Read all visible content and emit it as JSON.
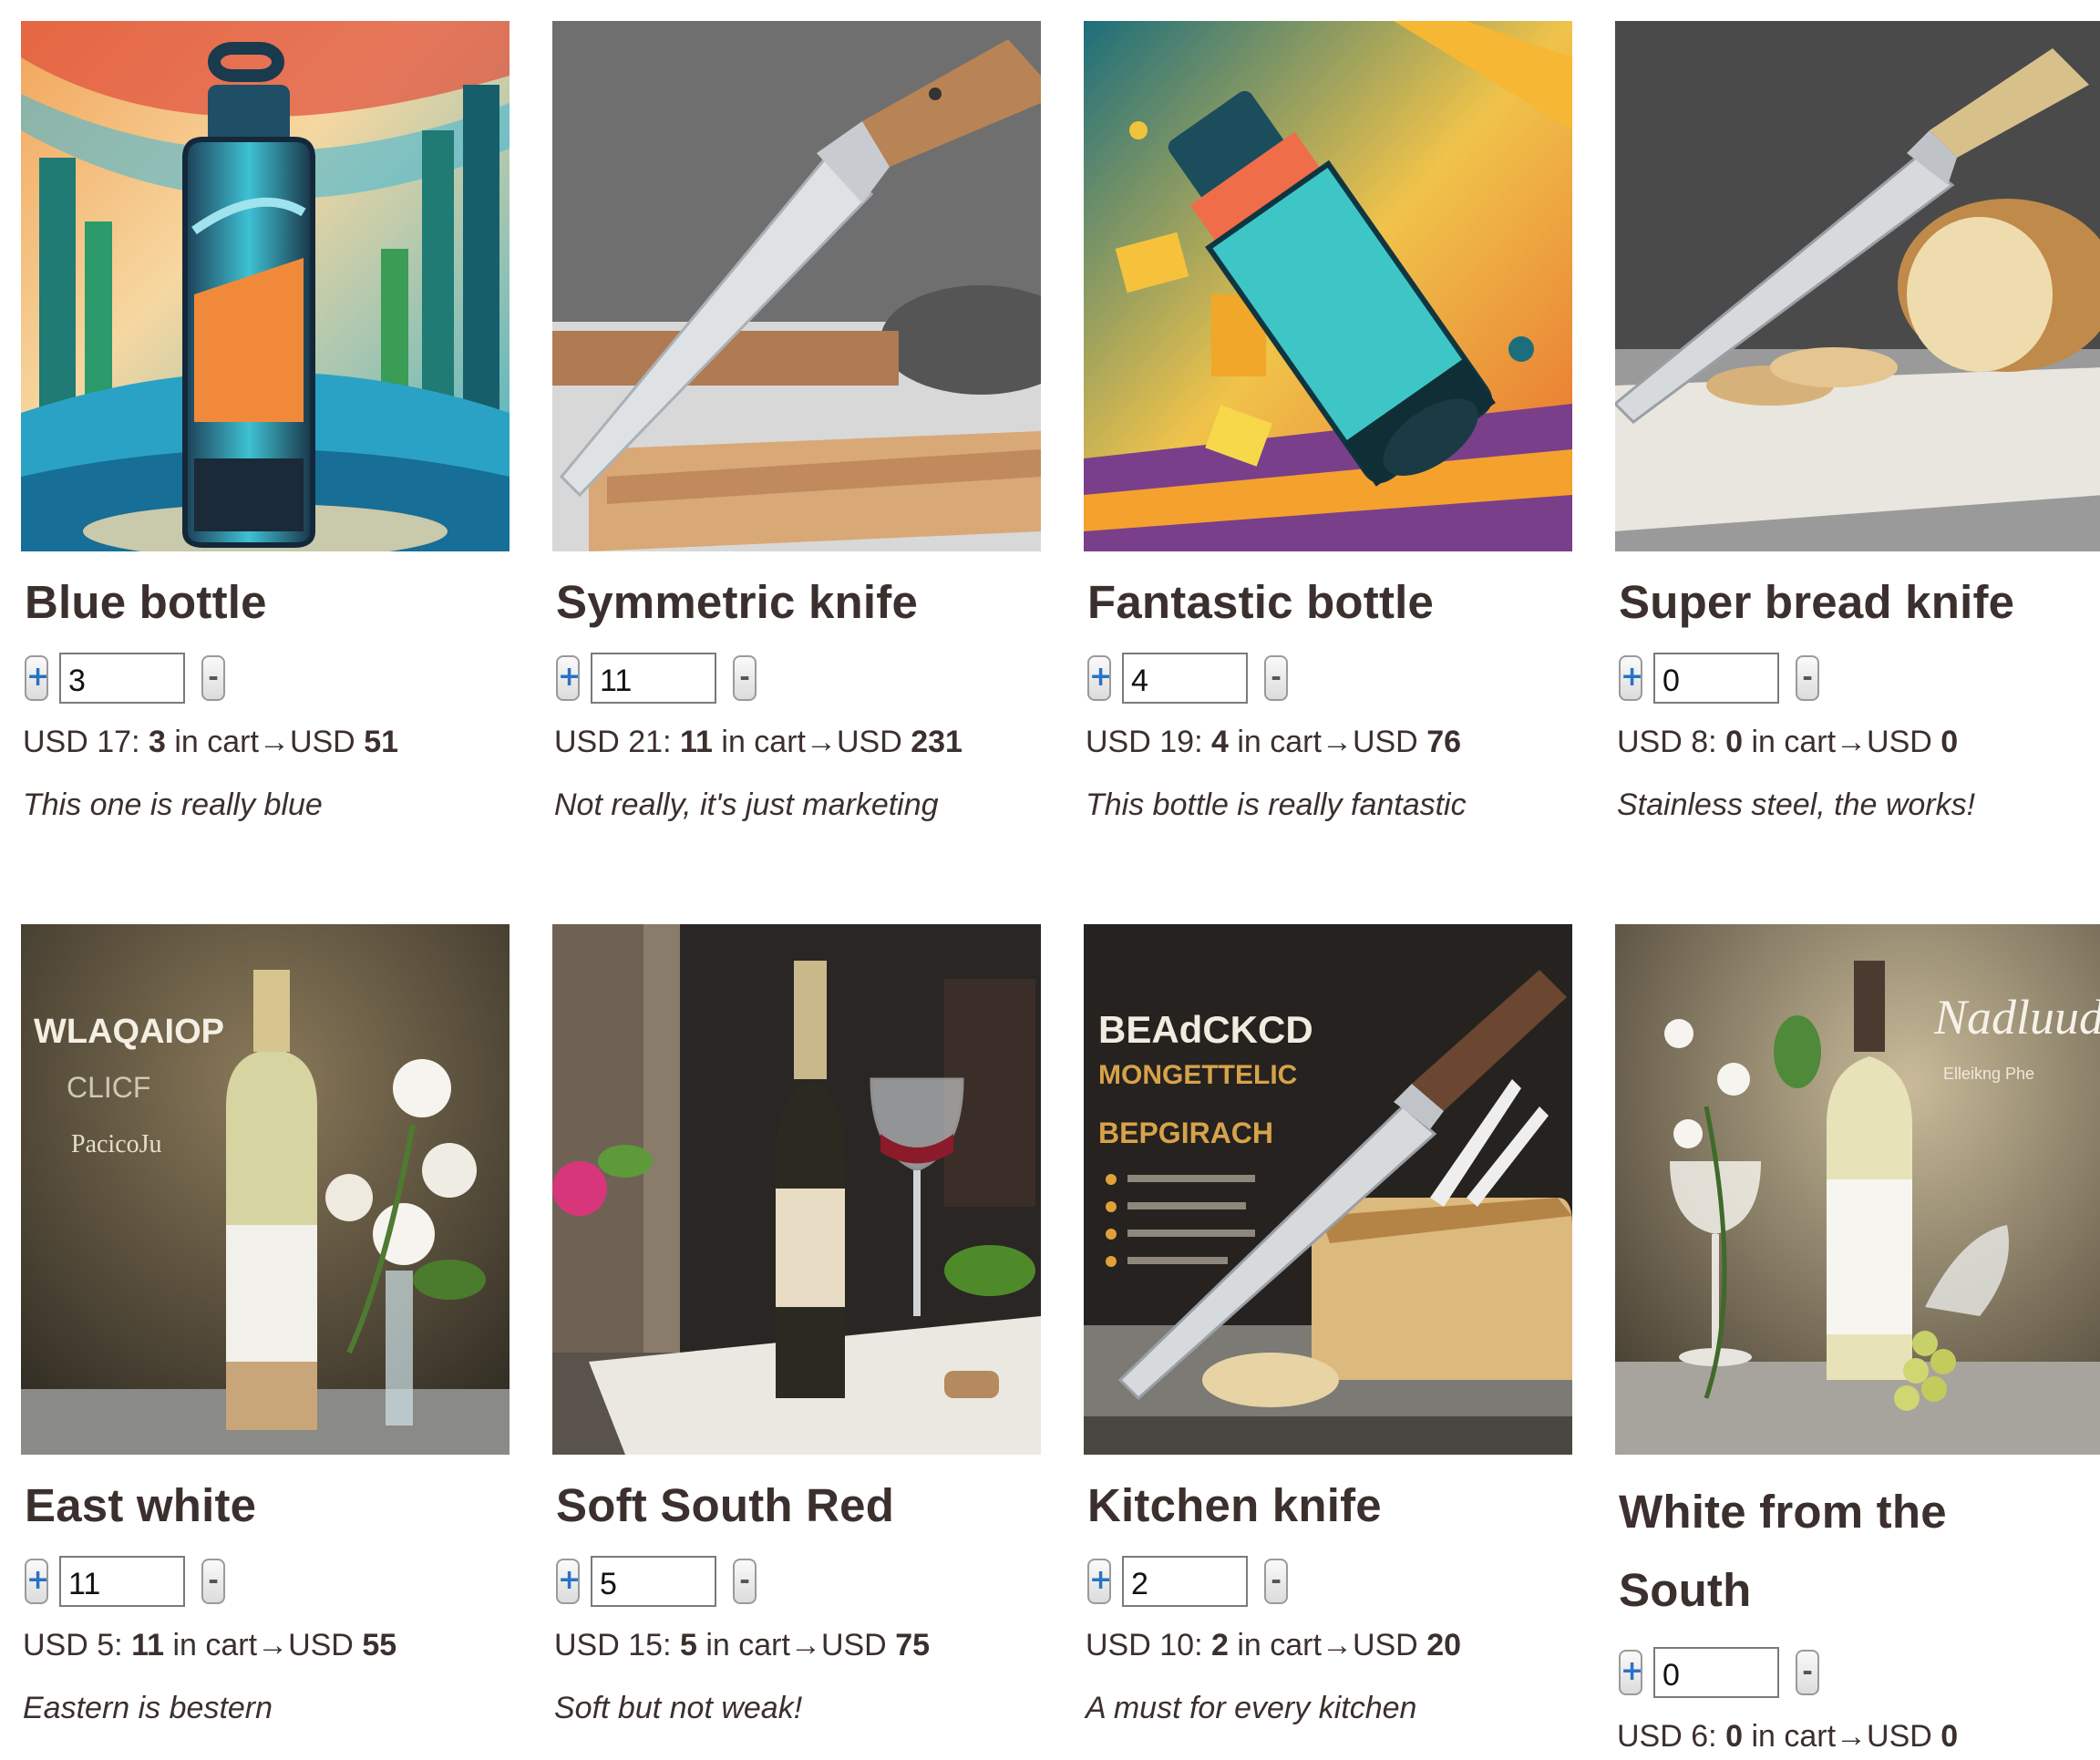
{
  "currency": "USD",
  "in_cart_label": "in cart",
  "arrow": "→",
  "plus_label": "+",
  "minus_label": "-",
  "products": [
    {
      "name": "Blue bottle",
      "price": "17",
      "qty": "3",
      "total": "51",
      "description": "This one is really blue"
    },
    {
      "name": "Symmetric knife",
      "price": "21",
      "qty": "11",
      "total": "231",
      "description": "Not really, it's just marketing"
    },
    {
      "name": "Fantastic bottle",
      "price": "19",
      "qty": "4",
      "total": "76",
      "description": "This bottle is really fantastic"
    },
    {
      "name": "Super bread knife",
      "price": "8",
      "qty": "0",
      "total": "0",
      "description": "Stainless steel, the works!"
    },
    {
      "name": "East white",
      "price": "5",
      "qty": "11",
      "total": "55",
      "description": "Eastern is bestern"
    },
    {
      "name": "Soft South Red",
      "price": "15",
      "qty": "5",
      "total": "75",
      "description": "Soft but not weak!"
    },
    {
      "name": "Kitchen knife",
      "price": "10",
      "qty": "2",
      "total": "20",
      "description": "A must for every kitchen"
    },
    {
      "name": "White from the South",
      "price": "6",
      "qty": "0",
      "total": "0",
      "description": ""
    }
  ],
  "image_text": {
    "east_white_label": "WLAQAIOP",
    "east_white_sub1": "CLICF",
    "east_white_sub2": "PacicoJu",
    "kitchen_title1": "BEAdCKCD",
    "kitchen_title2": "MONGETTELIC",
    "kitchen_title3": "BEPGIRACH",
    "white_south_label": "Nadluud",
    "white_south_sub": "Elleikng Phe"
  }
}
